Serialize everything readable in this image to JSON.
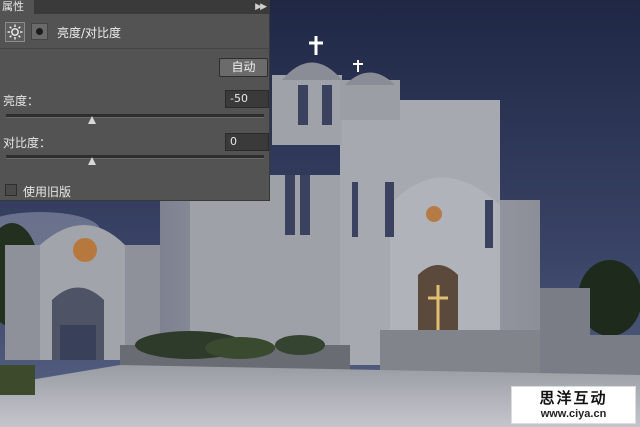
{
  "panel": {
    "tab_label": "属性",
    "collapse_icon": "double-chevron-right-icon",
    "header_icon": "brightness-sun-icon",
    "mask_icon": "layer-mask-icon",
    "title": "亮度/对比度",
    "auto_button": "自动",
    "brightness_label": "亮度：",
    "brightness_value": "-50",
    "brightness_slider": -50,
    "contrast_label": "对比度：",
    "contrast_value": "0",
    "contrast_slider": 0,
    "legacy_checked": false,
    "legacy_label": "使用旧版"
  },
  "watermark": {
    "line1": "思洋互动",
    "line2": "www.ciya.cn"
  }
}
